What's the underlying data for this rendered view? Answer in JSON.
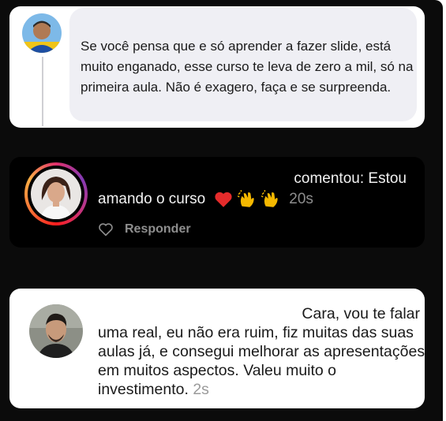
{
  "comments": [
    {
      "id": "c1",
      "text": "Se você pensa que e só aprender a fazer slide, está muito enganado, esse curso te leva de zero a mil, só na primeira aula. Não é exagero, faça e se surpreenda."
    },
    {
      "id": "c2",
      "line1": "comentou: Estou",
      "line2_text": "amando o curso",
      "emojis": [
        "red-heart-icon",
        "clapping-hands-icon",
        "clapping-hands-icon"
      ],
      "time": "20s",
      "reply_label": "Responder",
      "ring_colors": [
        "#e1306c",
        "#833ab4",
        "#fcaf45"
      ]
    },
    {
      "id": "c3",
      "first_line": "Cara, vou te falar",
      "rest": "uma real, eu não era ruim, fiz muitas das suas aulas já, e consegui melhorar as apresentações em muitos aspectos. Valeu muito o investimento.",
      "time": "2s"
    }
  ],
  "colors": {
    "dark_bg": "#0b0b0b",
    "bubble_gray": "#efeff4",
    "muted_text": "#8e8e8e",
    "heart": "#e52b2b"
  }
}
